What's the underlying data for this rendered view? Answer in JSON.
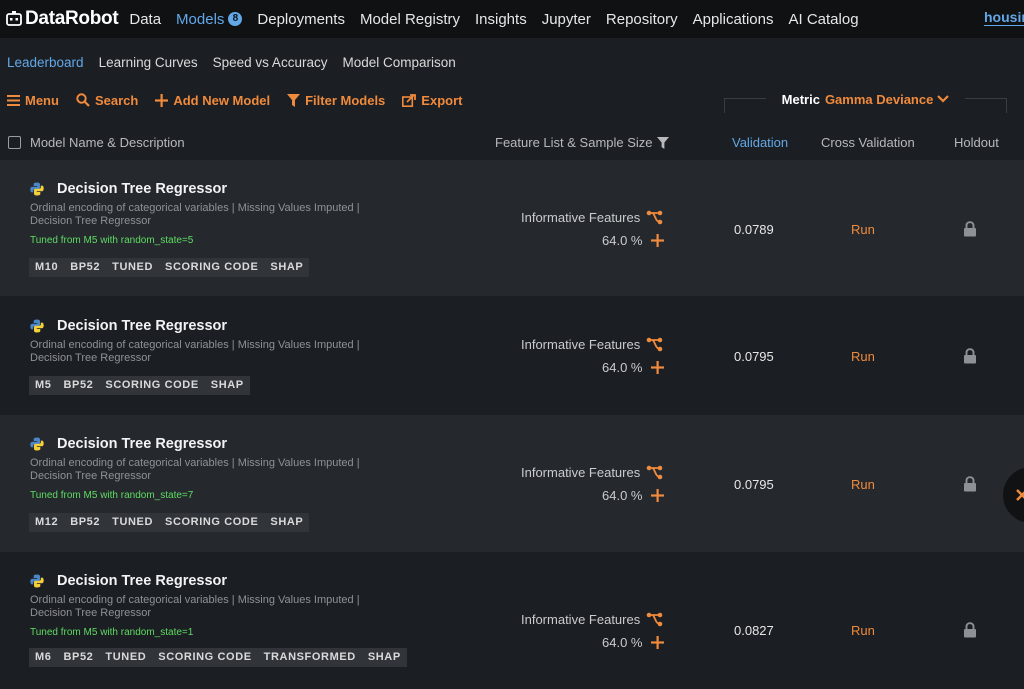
{
  "nav": {
    "brand": "DataRobot",
    "items": [
      {
        "label": "Data"
      },
      {
        "label": "Models",
        "badge": "8",
        "active": true
      },
      {
        "label": "Deployments"
      },
      {
        "label": "Model Registry"
      },
      {
        "label": "Insights"
      },
      {
        "label": "Jupyter"
      },
      {
        "label": "Repository"
      },
      {
        "label": "Applications"
      },
      {
        "label": "AI Catalog"
      }
    ],
    "project": "housing"
  },
  "subtabs": [
    "Leaderboard",
    "Learning Curves",
    "Speed vs Accuracy",
    "Model Comparison"
  ],
  "toolbar": {
    "menu": "Menu",
    "search": "Search",
    "add": "Add New Model",
    "filter": "Filter Models",
    "export": "Export",
    "metric_label": "Metric",
    "metric_value": "Gamma Deviance"
  },
  "table": {
    "headers": {
      "name": "Model Name & Description",
      "feature": "Feature List & Sample Size",
      "validation": "Validation",
      "cross_validation": "Cross Validation",
      "holdout": "Holdout"
    },
    "rows": [
      {
        "name": "Decision Tree Regressor",
        "desc": "Ordinal encoding of categorical variables | Missing Values Imputed | Decision Tree Regressor",
        "tuned": "Tuned from M5 with random_state=5",
        "tags": [
          "M10",
          "BP52",
          "TUNED",
          "SCORING CODE",
          "SHAP"
        ],
        "feature_list": "Informative Features",
        "sample_size": "64.0 %",
        "validation": "0.0789",
        "cross_validation": "Run"
      },
      {
        "name": "Decision Tree Regressor",
        "desc": "Ordinal encoding of categorical variables | Missing Values Imputed | Decision Tree Regressor",
        "tuned": "",
        "tags": [
          "M5",
          "BP52",
          "SCORING CODE",
          "SHAP"
        ],
        "feature_list": "Informative Features",
        "sample_size": "64.0 %",
        "validation": "0.0795",
        "cross_validation": "Run"
      },
      {
        "name": "Decision Tree Regressor",
        "desc": "Ordinal encoding of categorical variables | Missing Values Imputed | Decision Tree Regressor",
        "tuned": "Tuned from M5 with random_state=7",
        "tags": [
          "M12",
          "BP52",
          "TUNED",
          "SCORING CODE",
          "SHAP"
        ],
        "feature_list": "Informative Features",
        "sample_size": "64.0 %",
        "validation": "0.0795",
        "cross_validation": "Run"
      },
      {
        "name": "Decision Tree Regressor",
        "desc": "Ordinal encoding of categorical variables | Missing Values Imputed | Decision Tree Regressor",
        "tuned": "Tuned from M5 with random_state=1",
        "tags": [
          "M6",
          "BP52",
          "TUNED",
          "SCORING CODE",
          "TRANSFORMED",
          "SHAP"
        ],
        "feature_list": "Informative Features",
        "sample_size": "64.0 %",
        "validation": "0.0827",
        "cross_validation": "Run"
      }
    ]
  },
  "colors": {
    "accent_blue": "#62a8e9",
    "accent_orange": "#f08a3c",
    "tuned_green": "#5fdc62"
  }
}
